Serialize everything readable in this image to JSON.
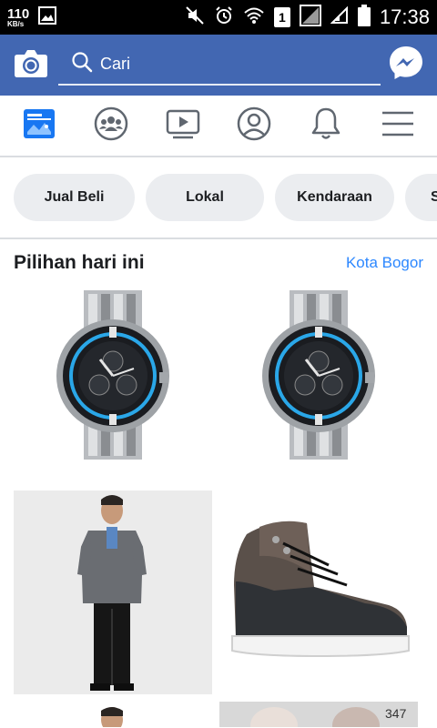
{
  "status_bar": {
    "speed_value": "110",
    "speed_unit": "KB/s",
    "sim_slot": "1",
    "time": "17:38"
  },
  "appbar": {
    "search_placeholder": "Cari",
    "camera_icon": "camera-icon",
    "messenger_icon": "messenger-icon",
    "brand_color": "#4267b2"
  },
  "nav": {
    "items": [
      {
        "icon": "marketplace-icon",
        "active": true
      },
      {
        "icon": "groups-icon"
      },
      {
        "icon": "watch-icon"
      },
      {
        "icon": "profile-icon"
      },
      {
        "icon": "notifications-icon"
      },
      {
        "icon": "menu-icon"
      }
    ]
  },
  "chips": {
    "items": [
      "Jual Beli",
      "Lokal",
      "Kendaraan",
      "S"
    ]
  },
  "section": {
    "title": "Pilihan hari ini",
    "location": "Kota Bogor"
  },
  "listings": [
    {
      "image": "watch-image"
    },
    {
      "image": "watch-image"
    },
    {
      "image": "shirt-model-image"
    },
    {
      "image": "sneaker-image"
    },
    {
      "image": "model-image"
    },
    {
      "image": "hijab-image"
    }
  ]
}
